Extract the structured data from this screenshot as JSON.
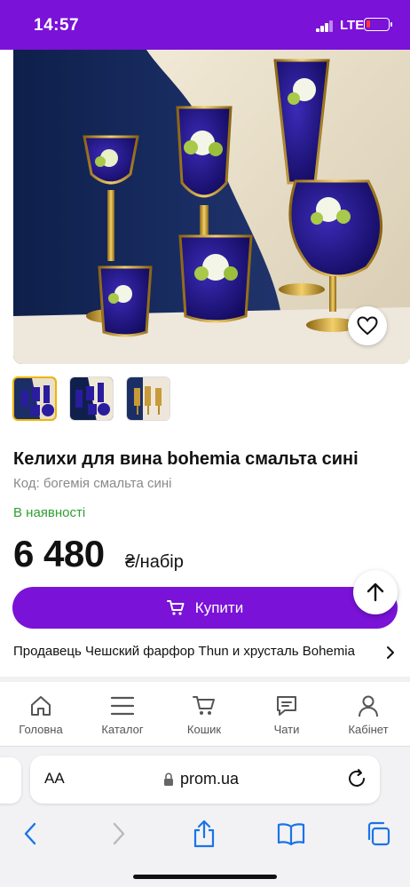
{
  "status_bar": {
    "time": "14:57",
    "network": "LTE"
  },
  "gallery": {
    "main_image_alt": "wine-glasses-photo",
    "thumbnails": [
      "thumb-set-1",
      "thumb-set-2",
      "thumb-set-3"
    ],
    "active_thumbnail": 0
  },
  "product": {
    "title": "Келихи для вина bohemia смальта сині",
    "code": "Код: богемія смальта сині",
    "availability": "В наявності",
    "price": "6 480",
    "price_unit": "₴/набір",
    "buy_label": "Купити",
    "seller": "Продавець Чешский фарфор Thun и хрусталь Bohemia"
  },
  "bottom_nav": {
    "items": [
      {
        "label": "Головна",
        "icon": "home-icon"
      },
      {
        "label": "Каталог",
        "icon": "menu-icon"
      },
      {
        "label": "Кошик",
        "icon": "cart-icon"
      },
      {
        "label": "Чати",
        "icon": "chat-icon"
      },
      {
        "label": "Кабінет",
        "icon": "user-icon"
      }
    ]
  },
  "browser": {
    "text_size_label": "AA",
    "url": "prom.ua"
  },
  "colors": {
    "brand": "#7a12d8",
    "availability": "#2f9e2f"
  }
}
